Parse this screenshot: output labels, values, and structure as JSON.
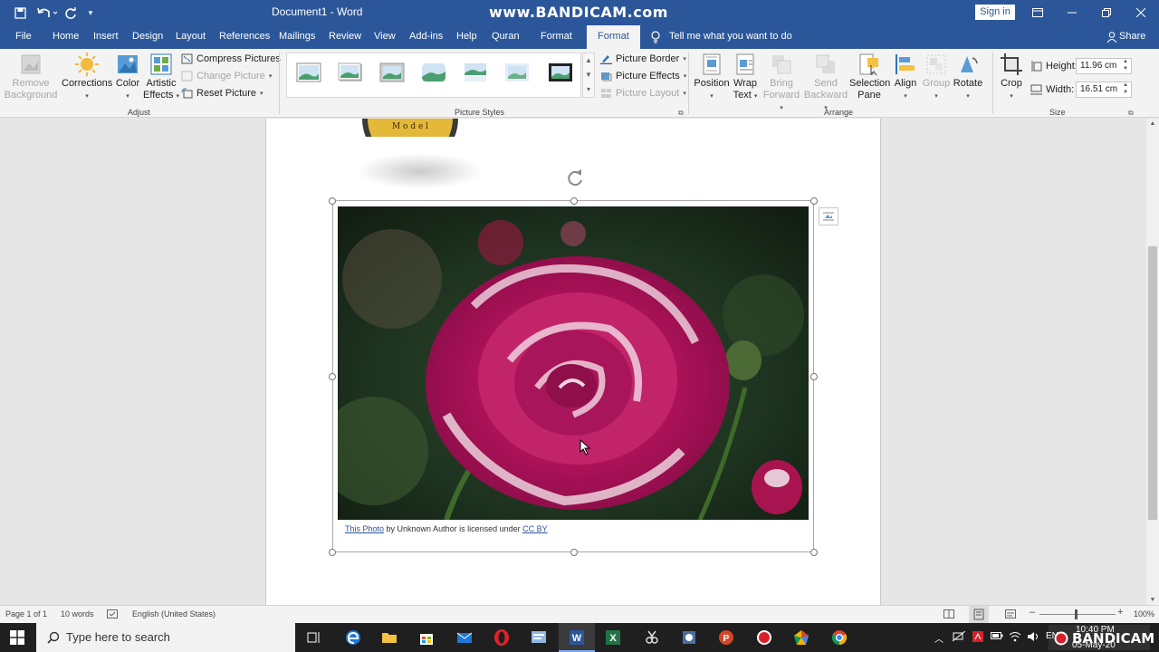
{
  "titlebar": {
    "doc_title": "Document1  -  Word",
    "watermark": "www.BANDICAM.com",
    "sign_in": "Sign in"
  },
  "tabs": [
    "File",
    "Home",
    "Insert",
    "Design",
    "Layout",
    "References",
    "Mailings",
    "Review",
    "View",
    "Add-ins",
    "Help",
    "Quran",
    "Format",
    "Format"
  ],
  "active_tab": "Format",
  "tell_me": "Tell me what you want to do",
  "share": "Share",
  "ribbon": {
    "adjust": {
      "remove_background": "Remove Background",
      "corrections": "Corrections",
      "color": "Color",
      "artistic_effects": "Artistic Effects",
      "compress": "Compress Pictures",
      "change": "Change Picture",
      "reset": "Reset Picture",
      "label": "Adjust"
    },
    "picture_styles": {
      "border": "Picture Border",
      "effects": "Picture Effects",
      "layout": "Picture Layout",
      "label": "Picture Styles"
    },
    "arrange": {
      "position": "Position",
      "wrap_text": "Wrap Text",
      "bring_forward": "Bring Forward",
      "send_backward": "Send Backward",
      "selection_pane": "Selection Pane",
      "align": "Align",
      "group": "Group",
      "rotate": "Rotate",
      "label": "Arrange"
    },
    "size": {
      "crop": "Crop",
      "height_label": "Height:",
      "height_value": "11.96 cm",
      "width_label": "Width:",
      "width_value": "16.51 cm",
      "label": "Size"
    }
  },
  "document": {
    "caption_link": "This Photo",
    "caption_mid": " by Unknown Author is licensed under ",
    "caption_license": "CC BY"
  },
  "statusbar": {
    "page": "Page 1 of 1",
    "words": "10 words",
    "language": "English (United States)",
    "zoom": "100%"
  },
  "taskbar": {
    "search_placeholder": "Type here to search",
    "time": "10:40 PM",
    "date": "05-May-20",
    "lang": "EN"
  }
}
